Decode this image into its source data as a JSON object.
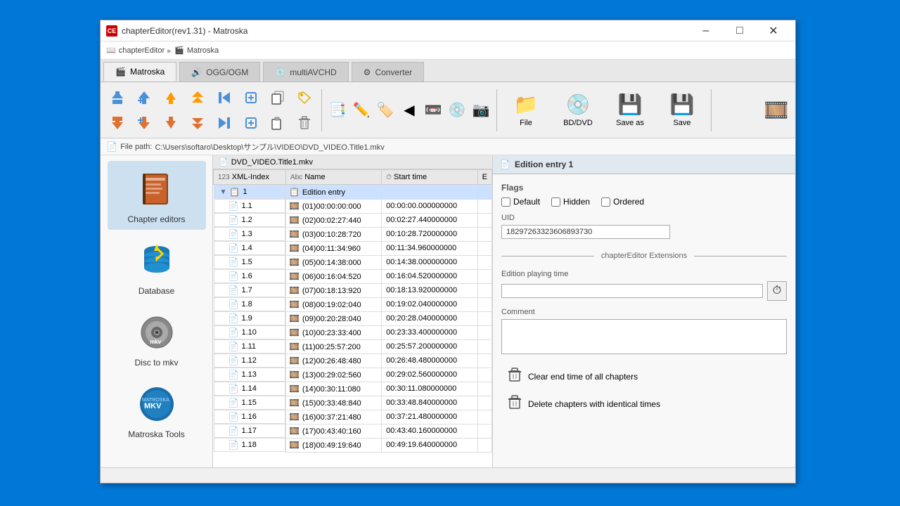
{
  "window": {
    "title": "chapterEditor(rev1.31) - Matroska",
    "minimize": "–",
    "maximize": "□",
    "close": "✕"
  },
  "breadcrumb": {
    "items": [
      {
        "label": "chapterEditor",
        "icon": "📖"
      },
      {
        "label": "Matroska",
        "icon": "🎬"
      }
    ]
  },
  "tabs": [
    {
      "label": "Matroska",
      "icon": "🎬",
      "active": true
    },
    {
      "label": "OGG/OGM",
      "icon": "🔊"
    },
    {
      "label": "multiAVCHD",
      "icon": "💿"
    },
    {
      "label": "Converter",
      "icon": "⚙"
    }
  ],
  "toolbar": {
    "buttons_row1": [
      {
        "id": "move-up",
        "icon": "⬆",
        "tooltip": "Move up"
      },
      {
        "id": "add-before",
        "icon": "↑+",
        "tooltip": "Add before"
      },
      {
        "id": "move-up2",
        "icon": "🔼",
        "tooltip": "Move up"
      },
      {
        "id": "move-up3",
        "icon": "⏫",
        "tooltip": "Move up fast"
      },
      {
        "id": "skip-start",
        "icon": "⏮",
        "tooltip": "Skip to start"
      },
      {
        "id": "add",
        "icon": "➕",
        "tooltip": "Add"
      },
      {
        "id": "copy",
        "icon": "📋",
        "tooltip": "Copy"
      },
      {
        "id": "tag",
        "icon": "🏷",
        "tooltip": "Tag"
      }
    ],
    "buttons_row2": [
      {
        "id": "move-down",
        "icon": "⬇",
        "tooltip": "Move down"
      },
      {
        "id": "add-after",
        "icon": "↓+",
        "tooltip": "Add after"
      },
      {
        "id": "move-down2",
        "icon": "🔽",
        "tooltip": "Move down"
      },
      {
        "id": "move-down3",
        "icon": "⏬",
        "tooltip": "Move down fast"
      },
      {
        "id": "skip-end",
        "icon": "⏭",
        "tooltip": "Skip to end"
      },
      {
        "id": "add2",
        "icon": "➕",
        "tooltip": "Add"
      },
      {
        "id": "paste",
        "icon": "📄",
        "tooltip": "Paste"
      },
      {
        "id": "delete",
        "icon": "🗑",
        "tooltip": "Delete"
      }
    ],
    "large_buttons": [
      {
        "id": "chapters-view",
        "icon": "📑",
        "label": ""
      },
      {
        "id": "edit",
        "icon": "✏",
        "label": ""
      },
      {
        "id": "tags",
        "icon": "🏷",
        "label": ""
      },
      {
        "id": "back",
        "icon": "◀",
        "label": ""
      },
      {
        "id": "video",
        "icon": "🎬",
        "label": ""
      },
      {
        "id": "disc",
        "icon": "💿",
        "label": ""
      },
      {
        "id": "settings",
        "icon": "⚙",
        "label": ""
      },
      {
        "id": "film",
        "icon": "🎞",
        "label": ""
      }
    ],
    "file_btn": {
      "label": "File",
      "icon": "📁"
    },
    "bd_dvd_btn": {
      "label": "BD/DVD",
      "icon": "💿"
    },
    "save_as_btn": {
      "label": "Save as",
      "icon": "💾"
    },
    "save_btn": {
      "label": "Save",
      "icon": "💾"
    }
  },
  "filepath": {
    "icon": "📄",
    "label": "File path:",
    "path": "C:\\Users\\softaro\\Desktop\\サンプル\\VIDEO\\DVD_VIDEO.Title1.mkv"
  },
  "file_tab": {
    "icon": "📄",
    "label": "DVD_VIDEO.Title1.mkv"
  },
  "sidebar": {
    "items": [
      {
        "id": "chapter-editors",
        "icon": "📖",
        "label": "Chapter editors",
        "active": true
      },
      {
        "id": "database",
        "icon": "⚡",
        "label": "Database"
      },
      {
        "id": "disc-to-mkv",
        "icon": "💿",
        "label": "Disc to mkv"
      },
      {
        "id": "matroska-tools",
        "icon": "🔵",
        "label": "Matroska Tools"
      }
    ]
  },
  "table": {
    "columns": [
      {
        "id": "xml-index",
        "label": "XML-Index"
      },
      {
        "id": "name",
        "label": "Name"
      },
      {
        "id": "start-time",
        "label": "Start time"
      },
      {
        "id": "e",
        "label": "E"
      }
    ],
    "rows": [
      {
        "xml_index": "1",
        "name": "Edition entry",
        "start_time": "",
        "e": "",
        "level": 0,
        "expandable": true,
        "selected": true
      },
      {
        "xml_index": "1.1",
        "name": "(01)00:00:00:000",
        "start_time": "00:00:00.000000000",
        "e": "",
        "level": 1
      },
      {
        "xml_index": "1.2",
        "name": "(02)00:02:27:440",
        "start_time": "00:02:27.440000000",
        "e": "",
        "level": 1
      },
      {
        "xml_index": "1.3",
        "name": "(03)00:10:28:720",
        "start_time": "00:10:28.720000000",
        "e": "",
        "level": 1
      },
      {
        "xml_index": "1.4",
        "name": "(04)00:11:34:960",
        "start_time": "00:11:34.960000000",
        "e": "",
        "level": 1
      },
      {
        "xml_index": "1.5",
        "name": "(05)00:14:38:000",
        "start_time": "00:14:38.000000000",
        "e": "",
        "level": 1
      },
      {
        "xml_index": "1.6",
        "name": "(06)00:16:04:520",
        "start_time": "00:16:04.520000000",
        "e": "",
        "level": 1
      },
      {
        "xml_index": "1.7",
        "name": "(07)00:18:13:920",
        "start_time": "00:18:13.920000000",
        "e": "",
        "level": 1
      },
      {
        "xml_index": "1.8",
        "name": "(08)00:19:02:040",
        "start_time": "00:19:02.040000000",
        "e": "",
        "level": 1
      },
      {
        "xml_index": "1.9",
        "name": "(09)00:20:28:040",
        "start_time": "00:20:28.040000000",
        "e": "",
        "level": 1
      },
      {
        "xml_index": "1.10",
        "name": "(10)00:23:33:400",
        "start_time": "00:23:33.400000000",
        "e": "",
        "level": 1
      },
      {
        "xml_index": "1.11",
        "name": "(11)00:25:57:200",
        "start_time": "00:25:57.200000000",
        "e": "",
        "level": 1
      },
      {
        "xml_index": "1.12",
        "name": "(12)00:26:48:480",
        "start_time": "00:26:48.480000000",
        "e": "",
        "level": 1
      },
      {
        "xml_index": "1.13",
        "name": "(13)00:29:02:560",
        "start_time": "00:29:02.560000000",
        "e": "",
        "level": 1
      },
      {
        "xml_index": "1.14",
        "name": "(14)00:30:11:080",
        "start_time": "00:30:11.080000000",
        "e": "",
        "level": 1
      },
      {
        "xml_index": "1.15",
        "name": "(15)00:33:48:840",
        "start_time": "00:33:48.840000000",
        "e": "",
        "level": 1
      },
      {
        "xml_index": "1.16",
        "name": "(16)00:37:21:480",
        "start_time": "00:37:21.480000000",
        "e": "",
        "level": 1
      },
      {
        "xml_index": "1.17",
        "name": "(17)00:43:40:160",
        "start_time": "00:43:40.160000000",
        "e": "",
        "level": 1
      },
      {
        "xml_index": "1.18",
        "name": "(18)00:49:19:640",
        "start_time": "00:49:19.640000000",
        "e": "",
        "level": 1
      }
    ]
  },
  "detail": {
    "title": "Edition entry 1",
    "title_icon": "📄",
    "flags_label": "Flags",
    "flags": {
      "default": {
        "label": "Default",
        "checked": false
      },
      "hidden": {
        "label": "Hidden",
        "checked": false
      },
      "ordered": {
        "label": "Ordered",
        "checked": false
      }
    },
    "uid_label": "UID",
    "uid_value": "18297263323606893730",
    "extensions_label": "chapterEditor Extensions",
    "playing_time_label": "Edition playing time",
    "playing_time_value": "",
    "comment_label": "Comment",
    "comment_value": "",
    "actions": [
      {
        "id": "clear-end-time",
        "label": "Clear end time of all chapters",
        "icon": "🗑"
      },
      {
        "id": "delete-identical",
        "label": "Delete chapters with identical times",
        "icon": "🗑"
      }
    ]
  }
}
